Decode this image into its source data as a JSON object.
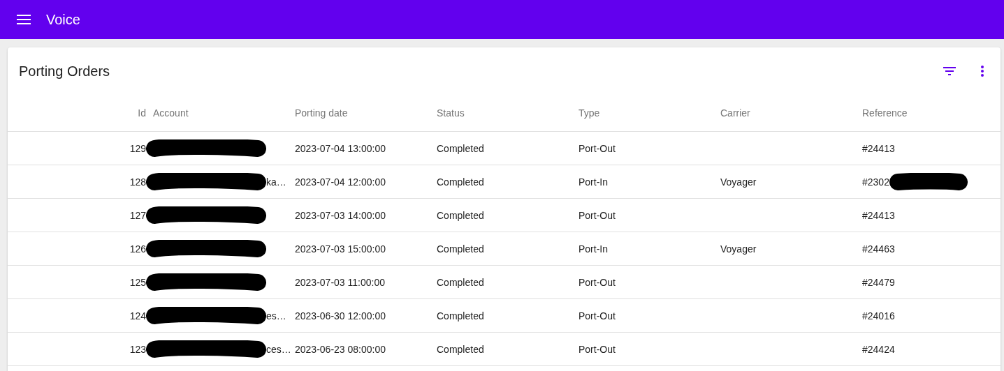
{
  "app_bar": {
    "title": "Voice"
  },
  "card": {
    "title": "Porting Orders"
  },
  "table": {
    "columns": [
      "Id",
      "Account",
      "Porting date",
      "Status",
      "Type",
      "Carrier",
      "Reference"
    ],
    "rows": [
      {
        "id": "129",
        "account": {
          "redacted": true
        },
        "date": "2023-07-04 13:00:00",
        "status": "Completed",
        "type": "Port-Out",
        "reference": {
          "text": "#24413",
          "redacted": false
        }
      },
      {
        "id": "128",
        "account": {
          "text": "ka…",
          "redacted": true
        },
        "date": "2023-07-04 12:00:00",
        "status": "Completed",
        "type": "Port-In",
        "carrier": "Voyager",
        "reference": {
          "text": "#2302",
          "redacted": true
        }
      },
      {
        "id": "127",
        "account": {
          "redacted": true
        },
        "date": "2023-07-03 14:00:00",
        "status": "Completed",
        "type": "Port-Out",
        "reference": {
          "text": "#24413",
          "redacted": false
        }
      },
      {
        "id": "126",
        "account": {
          "redacted": true
        },
        "date": "2023-07-03 15:00:00",
        "status": "Completed",
        "type": "Port-In",
        "carrier": "Voyager",
        "reference": {
          "text": "#24463",
          "redacted": false
        }
      },
      {
        "id": "125",
        "account": {
          "redacted": true
        },
        "date": "2023-07-03 11:00:00",
        "status": "Completed",
        "type": "Port-Out",
        "reference": {
          "text": "#24479",
          "redacted": false
        }
      },
      {
        "id": "124",
        "account": {
          "text": "es…",
          "redacted": true
        },
        "date": "2023-06-30 12:00:00",
        "status": "Completed",
        "type": "Port-Out",
        "reference": {
          "text": "#24016",
          "redacted": false
        }
      },
      {
        "id": "123",
        "account": {
          "text": "ces…",
          "redacted": true
        },
        "date": "2023-06-23 08:00:00",
        "status": "Completed",
        "type": "Port-Out",
        "reference": {
          "text": "#24424",
          "redacted": false
        }
      }
    ]
  }
}
